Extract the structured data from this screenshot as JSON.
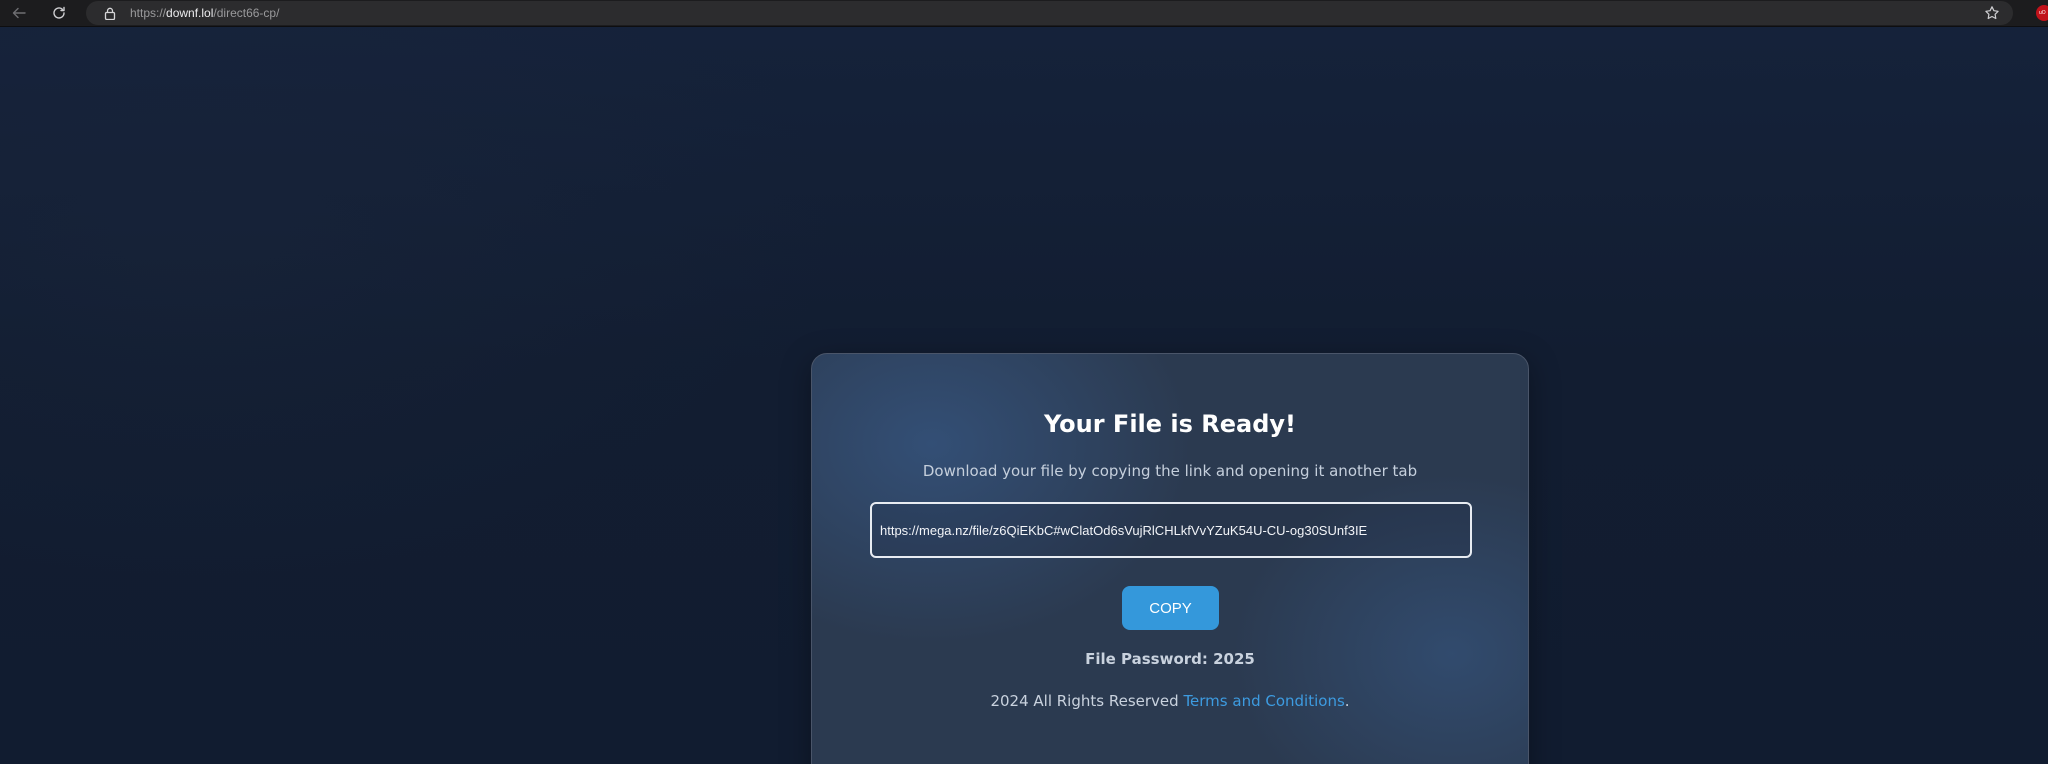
{
  "browser": {
    "url_scheme": "https://",
    "url_host": "downf.lol",
    "url_path": "/direct66-cp/",
    "extension_badge": "uO"
  },
  "card": {
    "title": "Your File is Ready!",
    "subtitle": "Download your file by copying the link and opening it another tab",
    "link_value": "https://mega.nz/file/z6QiEKbC#wClatOd6sVujRlCHLkfVvYZuK54U-CU-og30SUnf3IE",
    "copy_label": "COPY",
    "password_text": "File Password: 2025",
    "footer_text": "2024 All Rights Reserved",
    "terms_label": "Terms and Conditions",
    "footer_end": "."
  },
  "colors": {
    "accent": "#3498db",
    "page_background": "#131f33",
    "card_background": "#2b3a50"
  },
  "icons": {
    "back": "arrow-left-icon",
    "reload": "reload-icon",
    "lock": "lock-icon",
    "bookmark": "star-icon"
  }
}
